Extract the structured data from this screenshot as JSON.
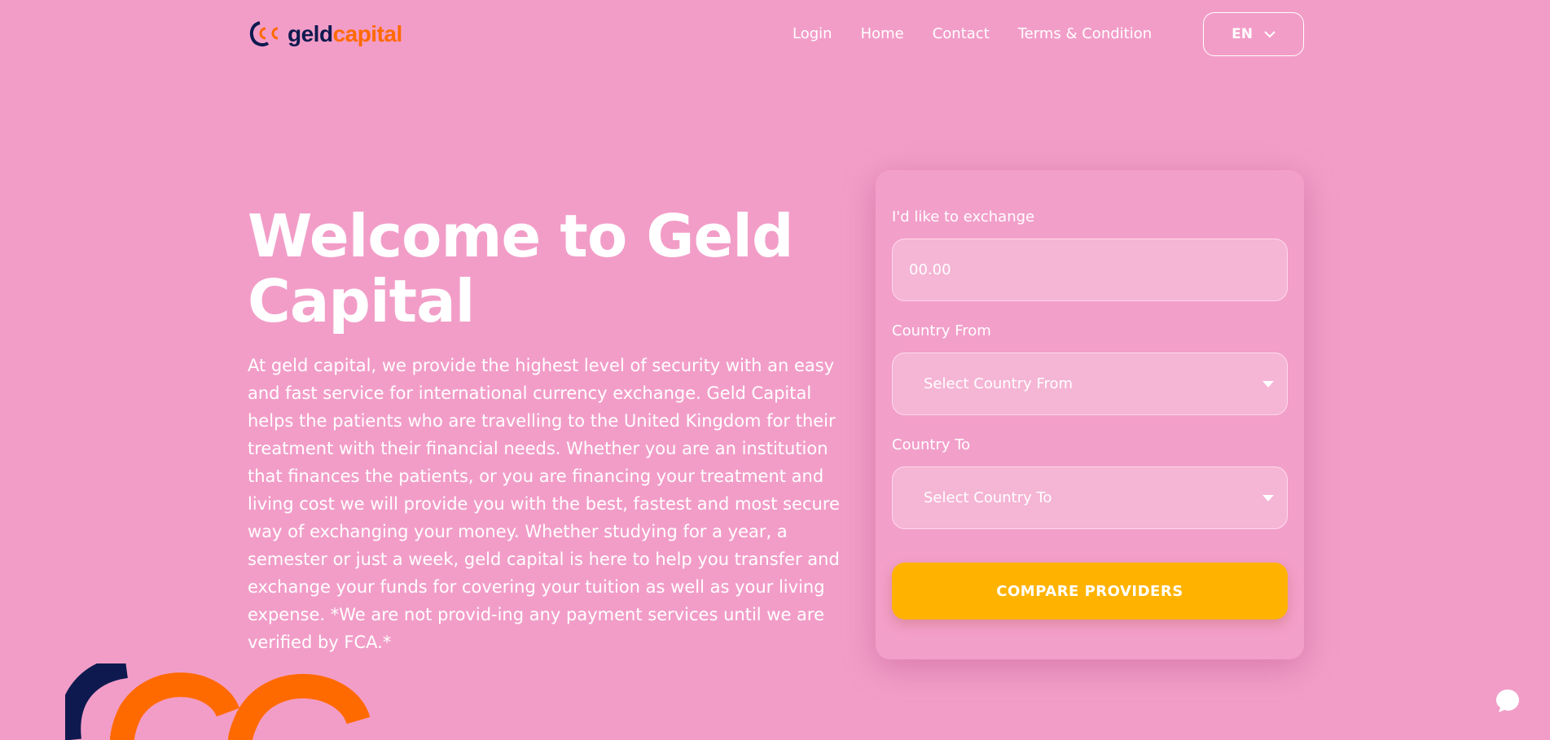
{
  "brand": {
    "logo_initials": "GC",
    "name_part1": "geld",
    "name_part2": "capital",
    "colors": {
      "navy": "#0e1a4f",
      "orange": "#ff6a00",
      "background": "#f29dc8",
      "button": "#ffb300"
    }
  },
  "nav": {
    "items": [
      "Login",
      "Home",
      "Contact",
      "Terms & Condition"
    ],
    "language": "EN"
  },
  "hero": {
    "title": "Welcome to Geld Capital",
    "description": "At geld capital, we provide the highest level of security with an easy and fast service for international currency exchange. Geld Capital helps the patients who are travelling to the United Kingdom for their treatment with their financial needs. Whether you are an institution that finances the patients, or you are financing your treatment and living cost we will provide you with the best, fastest and most secure way of exchanging your money. Whether studying for a year, a semester or just a week, geld capital is here to help you transfer and exchange your funds for covering your tuition as well as your living expense. *We are not provid-ing any payment services until we are verified by FCA.*"
  },
  "form": {
    "amount_label": "I'd like to exchange",
    "amount_placeholder": "00.00",
    "from_label": "Country From",
    "from_select": "Select Country From",
    "to_label": "Country To",
    "to_select": "Select Country To",
    "submit": "COMPARE PROVIDERS"
  },
  "icons": {
    "language_dropdown": "chevron-down-icon",
    "select_caret": "caret-down-icon",
    "chat": "chat-bubble-icon"
  }
}
